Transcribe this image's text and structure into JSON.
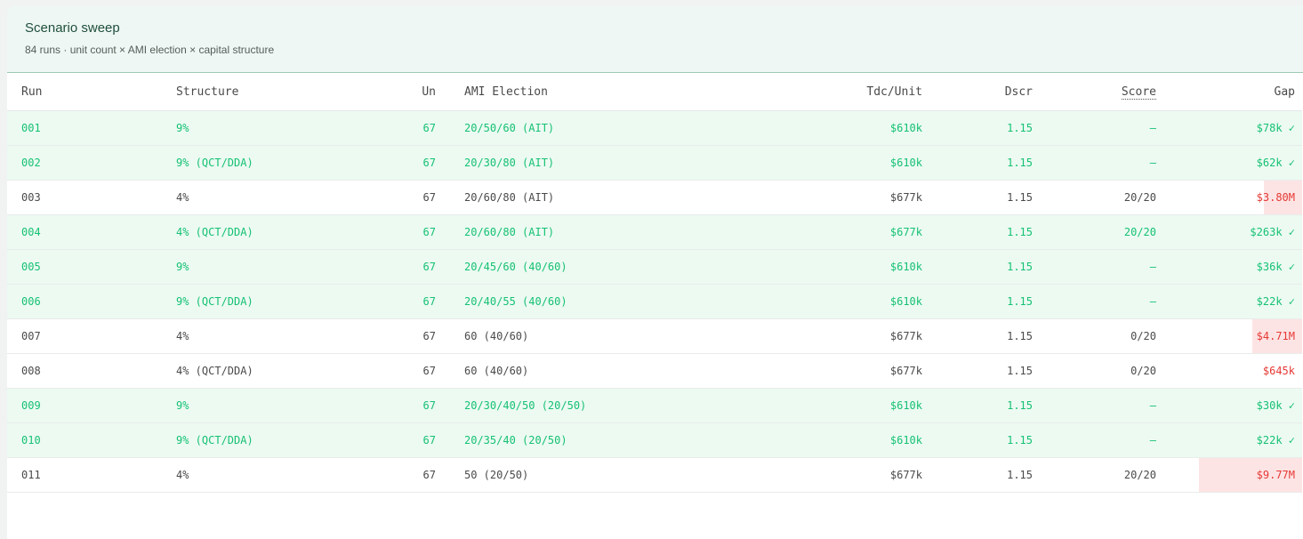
{
  "panel": {
    "title": "Scenario sweep",
    "subtitle": "84 runs · unit count × AMI election × capital structure"
  },
  "columns": [
    "Run",
    "Structure",
    "Un",
    "AMI Election",
    "Tdc/Unit",
    "Dscr",
    "Score",
    "Gap"
  ],
  "colors": {
    "pass_text": "#16c173",
    "pass_row": "#ecfaf2",
    "fail_text": "#e53935",
    "fail_bar": "#fde4e4"
  },
  "rows": [
    {
      "run": "001",
      "structure": "9%",
      "un": "67",
      "ami": "20/50/60 (AIT)",
      "tdc": "$610k",
      "dscr": "1.15",
      "score": "—",
      "gap": "$78k ✓",
      "status": "pass",
      "gap_bar_fraction": 0
    },
    {
      "run": "002",
      "structure": "9% (QCT/DDA)",
      "un": "67",
      "ami": "20/30/80 (AIT)",
      "tdc": "$610k",
      "dscr": "1.15",
      "score": "—",
      "gap": "$62k ✓",
      "status": "pass",
      "gap_bar_fraction": 0
    },
    {
      "run": "003",
      "structure": "4%",
      "un": "67",
      "ami": "20/60/80 (AIT)",
      "tdc": "$677k",
      "dscr": "1.15",
      "score": "20/20",
      "gap": "$3.80M",
      "status": "fail",
      "gap_bar_fraction": 0.26
    },
    {
      "run": "004",
      "structure": "4% (QCT/DDA)",
      "un": "67",
      "ami": "20/60/80 (AIT)",
      "tdc": "$677k",
      "dscr": "1.15",
      "score": "20/20",
      "gap": "$263k ✓",
      "status": "pass",
      "gap_bar_fraction": 0
    },
    {
      "run": "005",
      "structure": "9%",
      "un": "67",
      "ami": "20/45/60 (40/60)",
      "tdc": "$610k",
      "dscr": "1.15",
      "score": "—",
      "gap": "$36k ✓",
      "status": "pass",
      "gap_bar_fraction": 0
    },
    {
      "run": "006",
      "structure": "9% (QCT/DDA)",
      "un": "67",
      "ami": "20/40/55 (40/60)",
      "tdc": "$610k",
      "dscr": "1.15",
      "score": "—",
      "gap": "$22k ✓",
      "status": "pass",
      "gap_bar_fraction": 0
    },
    {
      "run": "007",
      "structure": "4%",
      "un": "67",
      "ami": "60 (40/60)",
      "tdc": "$677k",
      "dscr": "1.15",
      "score": "0/20",
      "gap": "$4.71M",
      "status": "fail",
      "gap_bar_fraction": 0.34
    },
    {
      "run": "008",
      "structure": "4% (QCT/DDA)",
      "un": "67",
      "ami": "60 (40/60)",
      "tdc": "$677k",
      "dscr": "1.15",
      "score": "0/20",
      "gap": "$645k",
      "status": "fail",
      "gap_bar_fraction": 0
    },
    {
      "run": "009",
      "structure": "9%",
      "un": "67",
      "ami": "20/30/40/50 (20/50)",
      "tdc": "$610k",
      "dscr": "1.15",
      "score": "—",
      "gap": "$30k ✓",
      "status": "pass",
      "gap_bar_fraction": 0
    },
    {
      "run": "010",
      "structure": "9% (QCT/DDA)",
      "un": "67",
      "ami": "20/35/40 (20/50)",
      "tdc": "$610k",
      "dscr": "1.15",
      "score": "—",
      "gap": "$22k ✓",
      "status": "pass",
      "gap_bar_fraction": 0
    },
    {
      "run": "011",
      "structure": "4%",
      "un": "67",
      "ami": "50 (20/50)",
      "tdc": "$677k",
      "dscr": "1.15",
      "score": "20/20",
      "gap": "$9.77M",
      "status": "fail",
      "gap_bar_fraction": 0.71
    }
  ]
}
